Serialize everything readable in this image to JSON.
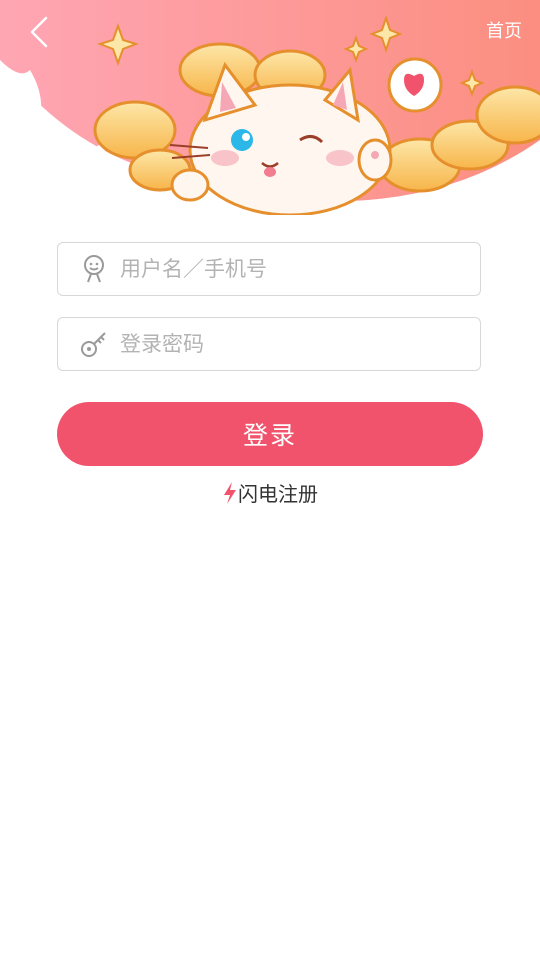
{
  "header": {
    "home_label": "首页",
    "gradient_start": "#ffb1b9",
    "gradient_end": "#fb8e82"
  },
  "form": {
    "username_placeholder": "用户名／手机号",
    "password_placeholder": "登录密码",
    "username_value": "",
    "password_value": ""
  },
  "actions": {
    "login_label": "登录",
    "register_label": "闪电注册",
    "accent": "#f2536c"
  },
  "icons": [
    "chevron-left-icon",
    "user-icon",
    "key-icon",
    "lightning-icon",
    "cat-mascot"
  ]
}
